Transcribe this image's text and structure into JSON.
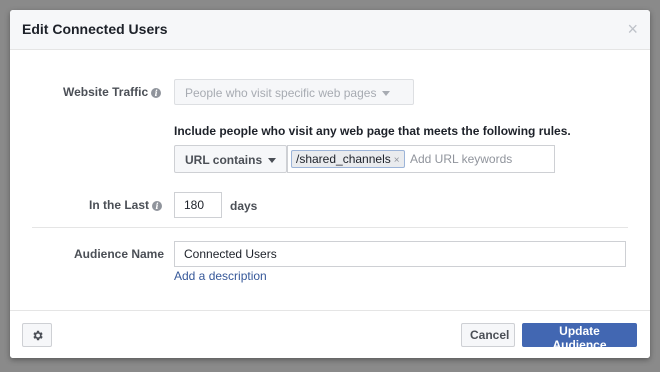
{
  "dialog": {
    "title": "Edit Connected Users",
    "close_symbol": "×"
  },
  "website_traffic": {
    "label": "Website Traffic",
    "info_icon": "info-icon",
    "selected": "People who visit specific web pages"
  },
  "rules": {
    "description": "Include people who visit any web page that meets the following rules.",
    "operator": "URL contains",
    "keywords": [
      "/shared_channels"
    ],
    "keyword_placeholder": "Add URL keywords",
    "remove_symbol": "×"
  },
  "duration": {
    "label": "In the Last",
    "value": "180",
    "unit": "days"
  },
  "audience": {
    "label": "Audience Name",
    "value": "Connected Users",
    "add_description": "Add a description"
  },
  "footer": {
    "settings_icon": "gear-icon",
    "cancel_label": "Cancel",
    "submit_label": "Update Audience"
  },
  "colors": {
    "primary": "#4267b2",
    "link": "#365899",
    "header_bg": "#f6f7f9"
  }
}
